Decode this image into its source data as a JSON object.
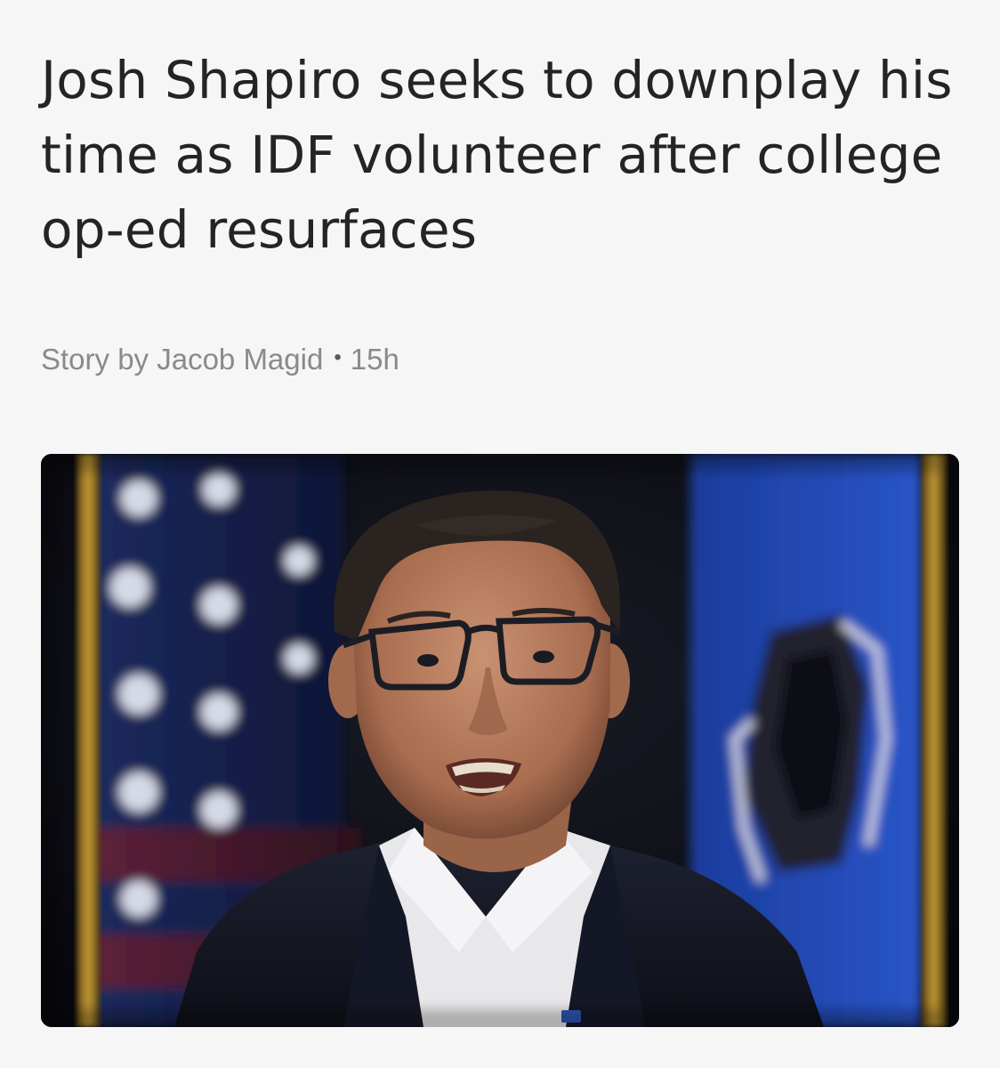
{
  "article": {
    "headline": "Josh Shapiro seeks to downplay his time as IDF volunteer after college op-ed resurfaces",
    "byline": {
      "prefix": "Story by",
      "author": "Jacob Magid",
      "separator": "•",
      "age": "15h"
    },
    "hero_image": {
      "alt": "Josh Shapiro speaking in front of American and Pennsylvania flags",
      "icon": "photo-image"
    }
  },
  "colors": {
    "background": "#f6f6f6",
    "headline": "#242424",
    "byline": "#8a8a8a"
  }
}
